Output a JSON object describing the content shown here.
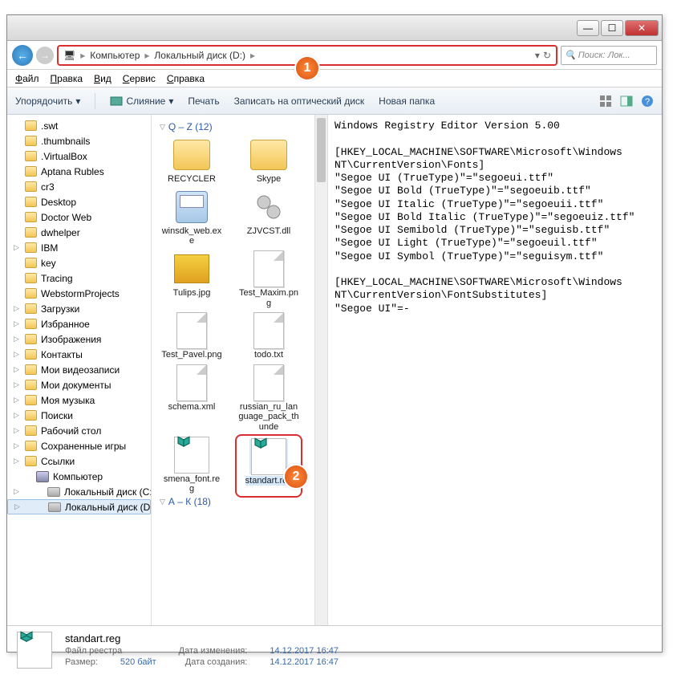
{
  "titlebar": {
    "min": "—",
    "max": "☐",
    "close": "✕"
  },
  "nav": {
    "back_glyph": "←",
    "fwd_glyph": "→",
    "addr_icon_glyph": "🖥",
    "crumbs": [
      "Компьютер",
      "Локальный диск (D:)"
    ],
    "sep": "▸",
    "dropdown_glyph": "▾",
    "refresh_glyph": "↻",
    "search_placeholder": "Поиск: Лок..."
  },
  "callouts": {
    "one": "1",
    "two": "2"
  },
  "menu": [
    "Файл",
    "Правка",
    "Вид",
    "Сервис",
    "Справка"
  ],
  "toolbar": {
    "organize": "Упорядочить",
    "merge": "Слияние",
    "print": "Печать",
    "burn": "Записать на оптический диск",
    "newfolder": "Новая папка",
    "dropdown_glyph": "▾"
  },
  "tree": [
    {
      "label": ".swt",
      "kind": "folder",
      "exp": false
    },
    {
      "label": ".thumbnails",
      "kind": "folder",
      "exp": false
    },
    {
      "label": ".VirtualBox",
      "kind": "folder",
      "exp": false
    },
    {
      "label": "Aptana Rubles",
      "kind": "folder",
      "exp": false
    },
    {
      "label": "cr3",
      "kind": "folder",
      "exp": false
    },
    {
      "label": "Desktop",
      "kind": "folder",
      "exp": false
    },
    {
      "label": "Doctor Web",
      "kind": "folder",
      "exp": false
    },
    {
      "label": "dwhelper",
      "kind": "folder",
      "exp": false
    },
    {
      "label": "IBM",
      "kind": "folder",
      "exp": true
    },
    {
      "label": "key",
      "kind": "folder",
      "exp": false
    },
    {
      "label": "Tracing",
      "kind": "folder",
      "exp": false
    },
    {
      "label": "WebstormProjects",
      "kind": "folder",
      "exp": false
    },
    {
      "label": "Загрузки",
      "kind": "folder",
      "exp": true
    },
    {
      "label": "Избранное",
      "kind": "folder",
      "exp": true
    },
    {
      "label": "Изображения",
      "kind": "folder",
      "exp": true
    },
    {
      "label": "Контакты",
      "kind": "folder",
      "exp": true
    },
    {
      "label": "Мои видеозаписи",
      "kind": "folder",
      "exp": true
    },
    {
      "label": "Мои документы",
      "kind": "folder",
      "exp": true
    },
    {
      "label": "Моя музыка",
      "kind": "folder",
      "exp": true
    },
    {
      "label": "Поиски",
      "kind": "folder",
      "exp": true
    },
    {
      "label": "Рабочий стол",
      "kind": "folder",
      "exp": true
    },
    {
      "label": "Сохраненные игры",
      "kind": "folder",
      "exp": true
    },
    {
      "label": "Ссылки",
      "kind": "folder",
      "exp": true
    },
    {
      "label": "Компьютер",
      "kind": "pc",
      "exp": false,
      "indent": 1
    },
    {
      "label": "Локальный диск (C:)",
      "kind": "drive",
      "exp": true,
      "indent": 2
    },
    {
      "label": "Локальный диск (D:)",
      "kind": "drive",
      "exp": true,
      "indent": 2,
      "selected": true
    }
  ],
  "groups": [
    {
      "header": "Q – Z (12)",
      "files": [
        {
          "name": "RECYCLER",
          "icon": "folder"
        },
        {
          "name": "Skype",
          "icon": "folder"
        },
        {
          "name": "winsdk_web.exe",
          "icon": "exe"
        },
        {
          "name": "ZJVCST.dll",
          "icon": "dll"
        },
        {
          "name": "Tulips.jpg",
          "icon": "img"
        },
        {
          "name": "Test_Maxim.png",
          "icon": "page"
        },
        {
          "name": "Test_Pavel.png",
          "icon": "page"
        },
        {
          "name": "todo.txt",
          "icon": "page"
        },
        {
          "name": "schema.xml",
          "icon": "page"
        },
        {
          "name": "russian_ru_language_pack_thunde",
          "icon": "page"
        },
        {
          "name": "smena_font.reg",
          "icon": "reg"
        },
        {
          "name": "standart.reg",
          "icon": "reg",
          "selected": true
        }
      ]
    },
    {
      "header": "А – К (18)",
      "files": []
    }
  ],
  "preview_text": "Windows Registry Editor Version 5.00\n\n[HKEY_LOCAL_MACHINE\\SOFTWARE\\Microsoft\\Windows NT\\CurrentVersion\\Fonts]\n\"Segoe UI (TrueType)\"=\"segoeui.ttf\"\n\"Segoe UI Bold (TrueType)\"=\"segoeuib.ttf\"\n\"Segoe UI Italic (TrueType)\"=\"segoeuii.ttf\"\n\"Segoe UI Bold Italic (TrueType)\"=\"segoeuiz.ttf\"\n\"Segoe UI Semibold (TrueType)\"=\"seguisb.ttf\"\n\"Segoe UI Light (TrueType)\"=\"segoeuil.ttf\"\n\"Segoe UI Symbol (TrueType)\"=\"seguisym.ttf\"\n\n[HKEY_LOCAL_MACHINE\\SOFTWARE\\Microsoft\\Windows NT\\CurrentVersion\\FontSubstitutes]\n\"Segoe UI\"=-",
  "details": {
    "name": "standart.reg",
    "type": "Файл реестра",
    "mod_label": "Дата изменения:",
    "mod_val": "14.12.2017 16:47",
    "size_label": "Размер:",
    "size_val": "520 байт",
    "created_label": "Дата создания:",
    "created_val": "14.12.2017 16:47"
  }
}
